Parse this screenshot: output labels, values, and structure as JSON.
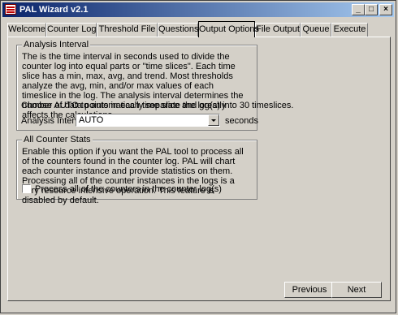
{
  "window": {
    "title": "PAL Wizard v2.1"
  },
  "titlebar": {
    "min": "_",
    "max": "□",
    "close": "×"
  },
  "tabs": [
    {
      "label": "Welcome"
    },
    {
      "label": "Counter Log"
    },
    {
      "label": "Threshold File"
    },
    {
      "label": "Questions"
    },
    {
      "label": "Output Options"
    },
    {
      "label": "File Output"
    },
    {
      "label": "Queue"
    },
    {
      "label": "Execute"
    }
  ],
  "analysis_interval": {
    "legend": "Analysis Interval",
    "description": "The is the time interval in seconds used to divide the counter log into equal parts or \"time slices\". Each time slice has a min, max, avg, and trend. Most thresholds analyze the avg, min, and/or max values of each timeslice in the log. The analysis interval determines the number of data points in each time slice and greatly affects the calculations.",
    "auto_note": "Choose AUTO to automatically separate the log(s) into 30 timeslices.",
    "field_label": "Analysis Interval:",
    "value": "AUTO",
    "unit": "seconds"
  },
  "all_counter_stats": {
    "legend": "All Counter Stats",
    "description": "Enable this option if you want the PAL tool to process all of the counters found in the counter log. PAL will chart each counter instance and provide statistics on them. Processing all of the counter instances in the logs is a very resource intensive operation. This feature is disabled by default.",
    "checkbox_label": "Process all of the counters in the counter log(s)",
    "checked": false
  },
  "footer": {
    "previous": "Previous",
    "next": "Next"
  }
}
